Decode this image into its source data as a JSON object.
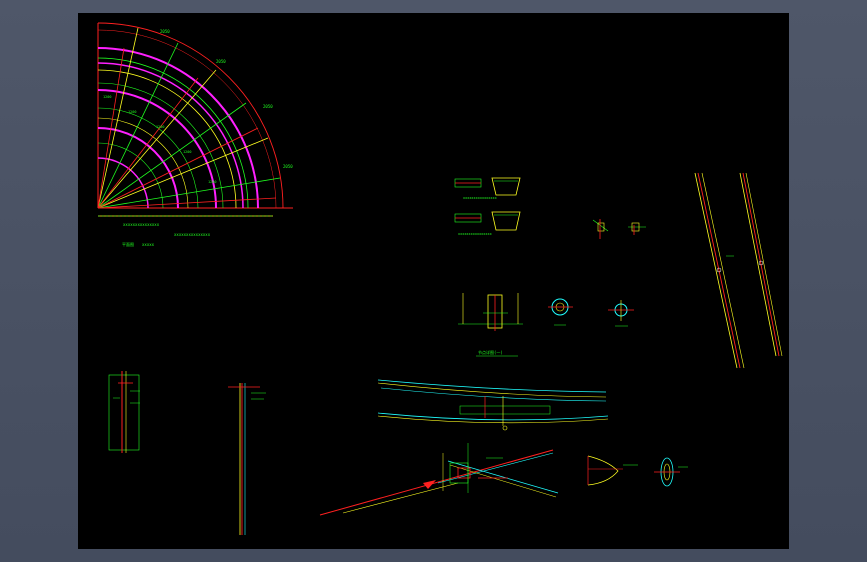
{
  "colors": {
    "background": "#4a5264",
    "sheet": "#000000",
    "red": "#ff2020",
    "green": "#20ff20",
    "yellow": "#ffff20",
    "magenta": "#ff20ff",
    "cyan": "#20ffff",
    "white": "#ffffff"
  },
  "sheet": {
    "fan_plan": {
      "caption": "平面图",
      "note": "xxxxx",
      "dimension_note": "xxxxxxxxxxxxxxx"
    },
    "section_details": {
      "label_a": "xxxxxxxxxxxxxxxx",
      "label_b": "xxxxxxxxxxxxxxxx"
    },
    "node_detail": {
      "caption": "节点详图(一)"
    },
    "icons": [
      "compass-arrow-icon"
    ]
  }
}
